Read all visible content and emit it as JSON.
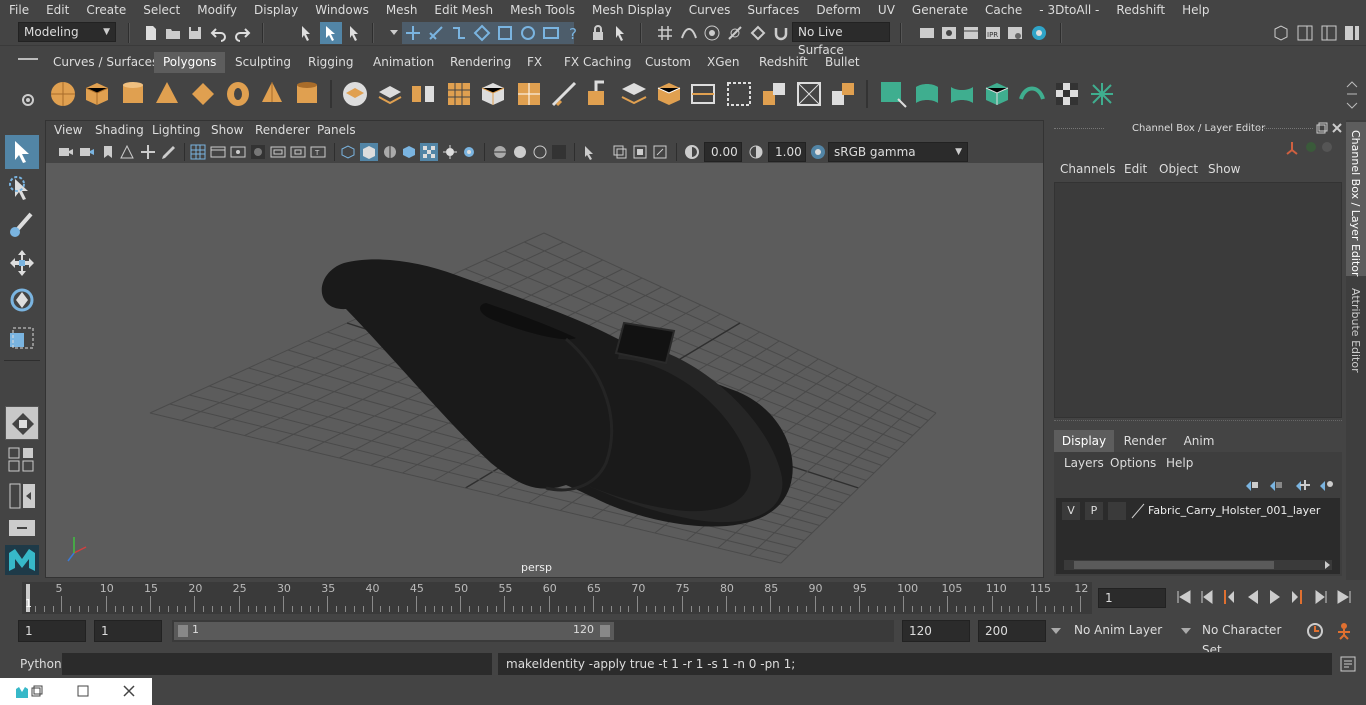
{
  "menubar": {
    "items": [
      "File",
      "Edit",
      "Create",
      "Select",
      "Modify",
      "Display",
      "Windows",
      "Mesh",
      "Edit Mesh",
      "Mesh Tools",
      "Mesh Display",
      "Curves",
      "Surfaces",
      "Deform",
      "UV",
      "Generate",
      "Cache",
      "- 3DtoAll -",
      "Redshift",
      "Help"
    ]
  },
  "statusline": {
    "mode": "Modeling",
    "live_surface": "No Live Surface"
  },
  "shelf": {
    "tabs": [
      "Curves / Surfaces",
      "Polygons",
      "Sculpting",
      "Rigging",
      "Animation",
      "Rendering",
      "FX",
      "FX Caching",
      "Custom",
      "XGen",
      "Redshift",
      "Bullet"
    ],
    "active_tab": "Polygons"
  },
  "viewport": {
    "menus": [
      "View",
      "Shading",
      "Lighting",
      "Show",
      "Renderer",
      "Panels"
    ],
    "exposure": "0.00",
    "gamma": "1.00",
    "color_space": "sRGB gamma",
    "camera_label": "persp"
  },
  "channel_box": {
    "title": "Channel Box / Layer Editor",
    "menus": [
      "Channels",
      "Edit",
      "Object",
      "Show"
    ],
    "layer_tabs": [
      "Display",
      "Render",
      "Anim"
    ],
    "active_layer_tab": "Display",
    "layer_menus": [
      "Layers",
      "Options",
      "Help"
    ],
    "layer": {
      "v": "V",
      "p": "P",
      "name": "Fabric_Carry_Holster_001_layer"
    }
  },
  "side_tabs": [
    "Channel Box / Layer Editor",
    "Attribute Editor"
  ],
  "timeline": {
    "ticks": [
      "5",
      "10",
      "15",
      "20",
      "25",
      "30",
      "35",
      "40",
      "45",
      "50",
      "55",
      "60",
      "65",
      "70",
      "75",
      "80",
      "85",
      "90",
      "95",
      "100",
      "105",
      "110",
      "115",
      "12"
    ],
    "start_label": "1",
    "current_frame": "1"
  },
  "range": {
    "start": "1",
    "playback_start": "1",
    "slider_start": "1",
    "slider_end": "120",
    "playback_end": "120",
    "end": "200",
    "anim_layer": "No Anim Layer",
    "character_set": "No Character Set"
  },
  "command": {
    "language": "Python",
    "output": "makeIdentity -apply true -t 1 -r 1 -s 1 -n 0 -pn 1;"
  },
  "colors": {
    "bg": "#444444",
    "viewport_bg": "#5d5d5d",
    "accent_blue": "#5285a6",
    "shelf_orange": "#e0a050",
    "shelf_green": "#3fae8f"
  }
}
